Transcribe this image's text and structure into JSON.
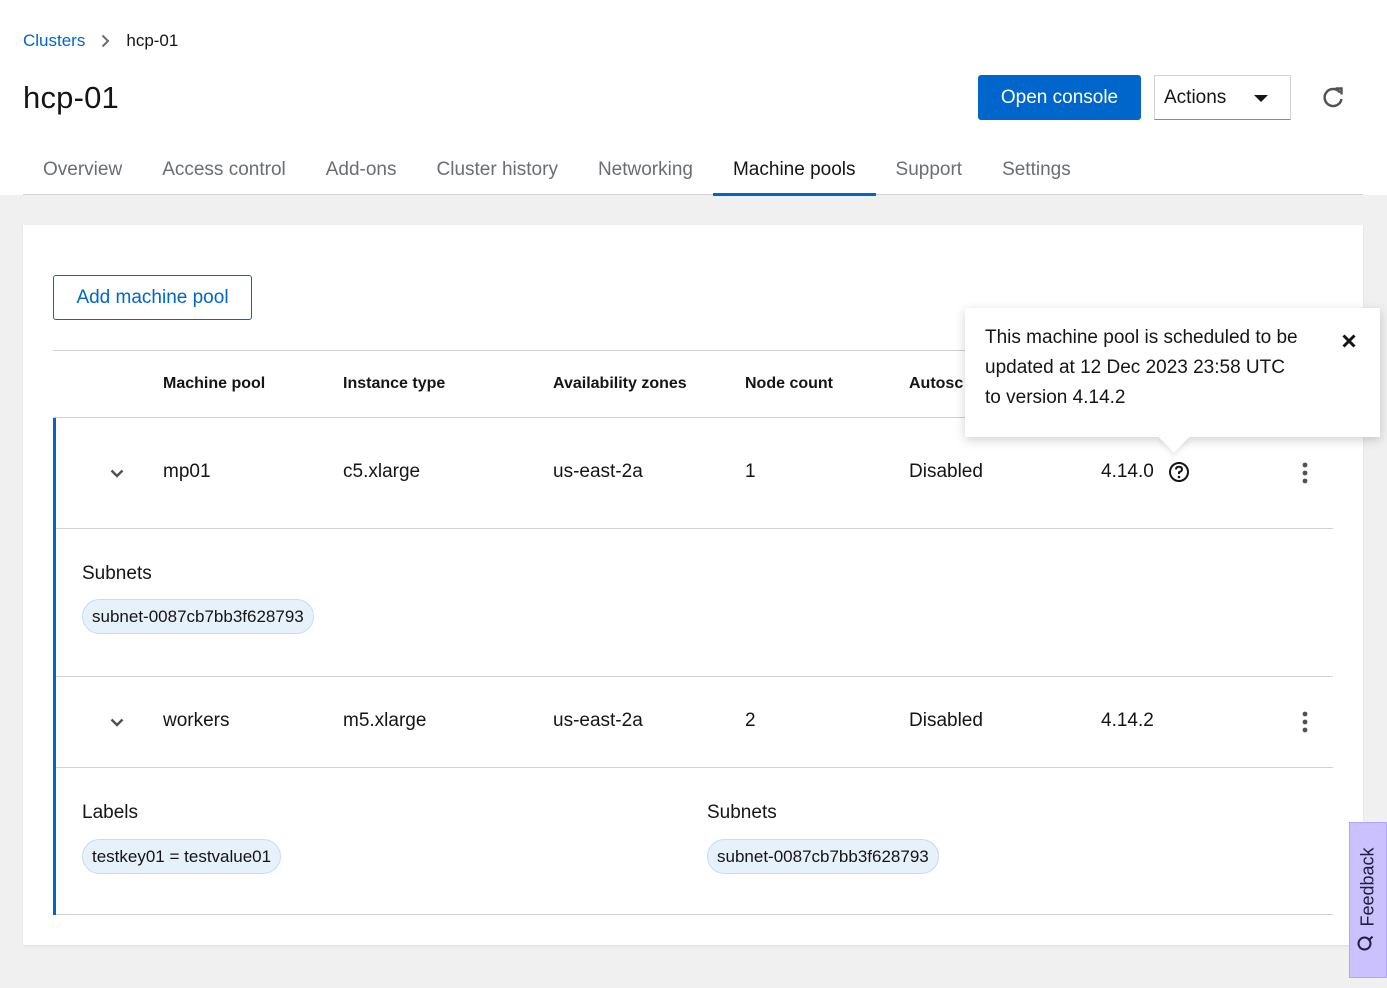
{
  "breadcrumb": {
    "parent": "Clusters",
    "current": "hcp-01"
  },
  "header": {
    "title": "hcp-01",
    "open_console": "Open console",
    "actions": "Actions"
  },
  "tabs": [
    "Overview",
    "Access control",
    "Add-ons",
    "Cluster history",
    "Networking",
    "Machine pools",
    "Support",
    "Settings"
  ],
  "active_tab": "Machine pools",
  "add_button": "Add machine pool",
  "table": {
    "columns": [
      "Machine pool",
      "Instance type",
      "Availability zones",
      "Node count",
      "Autosc"
    ],
    "rows": [
      {
        "name": "mp01",
        "instance": "c5.xlarge",
        "zones": "us-east-2a",
        "nodes": "1",
        "autoscaling": "Disabled",
        "version": "4.14.0",
        "subnets_title": "Subnets",
        "subnet": "subnet-0087cb7bb3f628793"
      },
      {
        "name": "workers",
        "instance": "m5.xlarge",
        "zones": "us-east-2a",
        "nodes": "2",
        "autoscaling": "Disabled",
        "version": "4.14.2",
        "labels_title": "Labels",
        "label": "testkey01 = testvalue01",
        "subnets_title": "Subnets",
        "subnet": "subnet-0087cb7bb3f628793"
      }
    ]
  },
  "popover": {
    "text": "This machine pool is scheduled to be updated at 12 Dec 2023 23:58 UTC to version 4.14.2"
  },
  "feedback": "Feedback",
  "colors": {
    "primary": "#0066cc",
    "chip_bg": "#e7f1fa",
    "feedback_bg": "#cbc1ff"
  },
  "icons": [
    "chevron-right-icon",
    "caret-down-icon",
    "refresh-icon",
    "chevron-down-icon",
    "help-icon",
    "kebab-icon",
    "close-icon",
    "feedback-icon"
  ]
}
